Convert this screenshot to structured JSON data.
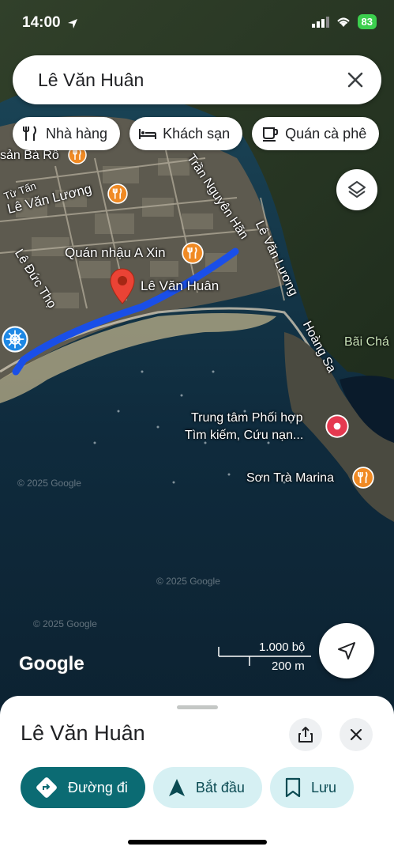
{
  "status_bar": {
    "time": "14:00",
    "battery": "83"
  },
  "search": {
    "value": "Lê Văn Huân"
  },
  "chips": [
    {
      "label": "Nhà hàng",
      "icon": "fork-knife-icon"
    },
    {
      "label": "Khách sạn",
      "icon": "bed-icon"
    },
    {
      "label": "Quán cà phê",
      "icon": "coffee-cup-icon"
    }
  ],
  "map": {
    "labels": {
      "ba_ro": "sản Bà Rô",
      "tu_tan": "Từ Tấn",
      "le_van_luong_1": "Lê Văn Lương",
      "tran_nguyen_han": "Trần Nguyên Hãn",
      "quan_nhau": "Quán nhậu A Xin",
      "le_van_luong_2": "Lê Văn Lương",
      "le_duc_tho": "Lê Đức Thọ",
      "pin_label": "Lê Văn Huân",
      "hoang_sa": "Hoàng Sa",
      "bai_cha": "Bãi Chá",
      "trung_tam_1": "Trung tâm Phối hợp",
      "trung_tam_2": "Tìm kiếm, Cứu nạn...",
      "son_tra": "Sơn Trà Marina",
      "copyright_1": "© 2025 Google",
      "copyright_2": "© 2025 Google",
      "copyright_3": "© 2025 Google"
    },
    "google_logo": "Google",
    "scale": {
      "top": "1.000 bộ",
      "bottom": "200 m"
    },
    "colors": {
      "route": "#1a4fe8",
      "water": "#0e2a3d",
      "land": "#3b4a3a"
    }
  },
  "sheet": {
    "title": "Lê Văn Huân",
    "actions": [
      {
        "label": "Đường đi",
        "icon": "directions-icon"
      },
      {
        "label": "Bắt đầu",
        "icon": "navigation-arrow-icon"
      },
      {
        "label": "Lưu",
        "icon": "bookmark-icon"
      }
    ]
  }
}
